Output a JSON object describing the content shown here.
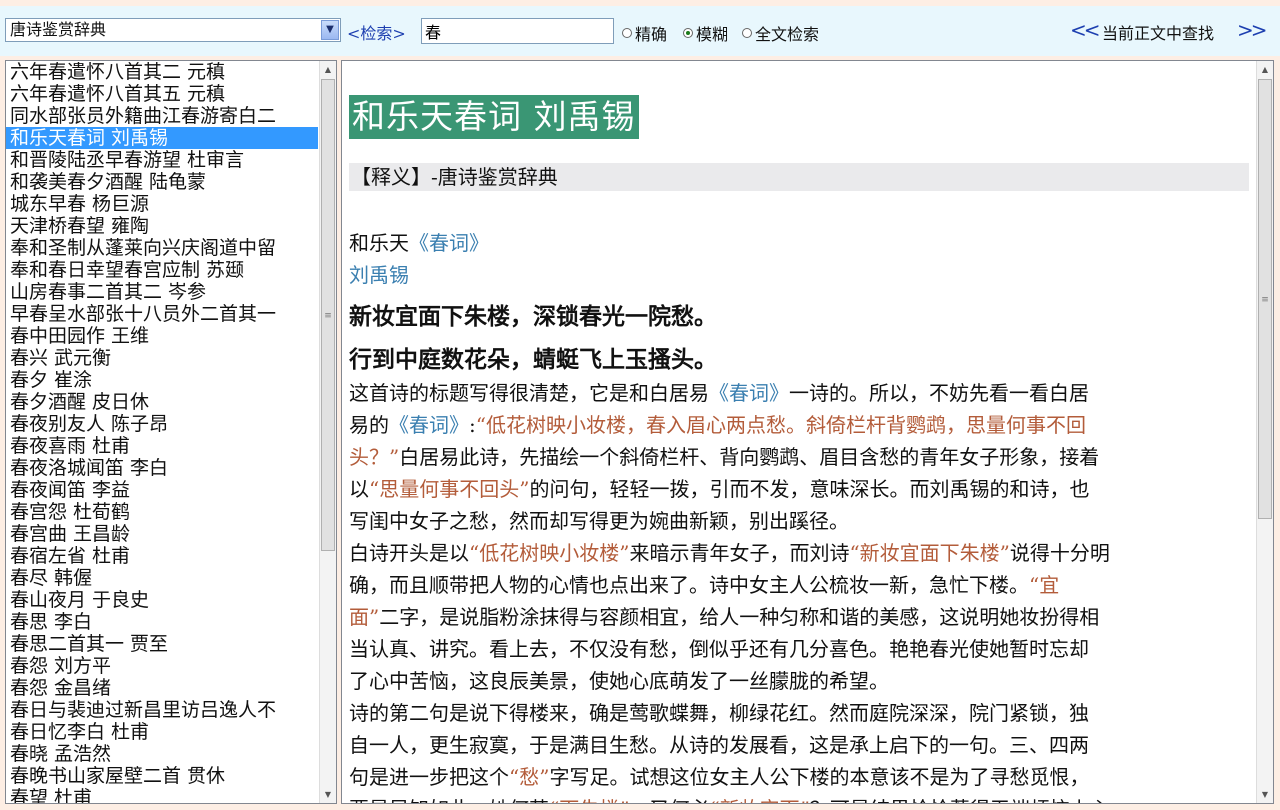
{
  "toolbar": {
    "dictionary": "唐诗鉴赏辞典",
    "search_label": "<检索>",
    "search_value": "春",
    "modes": [
      {
        "label": "精确",
        "selected": false
      },
      {
        "label": "模糊",
        "selected": true
      },
      {
        "label": "全文检索",
        "selected": false
      }
    ],
    "prev_label": "<<",
    "find_label": "当前正文中查找",
    "next_label": ">>"
  },
  "list": {
    "selected_index": 3,
    "items": [
      "六年春遣怀八首其二  元稹",
      "六年春遣怀八首其五  元稹",
      "同水部张员外籍曲江春游寄白二",
      "和乐天春词  刘禹锡",
      "和晋陵陆丞早春游望  杜审言",
      "和袭美春夕酒醒  陆龟蒙",
      "城东早春  杨巨源",
      "天津桥春望  雍陶",
      "奉和圣制从蓬莱向兴庆阁道中留",
      "奉和春日幸望春宫应制  苏颋",
      "山房春事二首其二  岑参",
      "早春呈水部张十八员外二首其一",
      "春中田园作  王维",
      "春兴  武元衡",
      "春夕  崔涂",
      "春夕酒醒  皮日休",
      "春夜别友人  陈子昂",
      "春夜喜雨  杜甫",
      "春夜洛城闻笛  李白",
      "春夜闻笛  李益",
      "春宫怨  杜荀鹤",
      "春宫曲  王昌龄",
      "春宿左省  杜甫",
      "春尽  韩偓",
      "春山夜月  于良史",
      "春思  李白",
      "春思二首其一  贾至",
      "春怨  刘方平",
      "春怨  金昌绪",
      "春日与裴迪过新昌里访吕逸人不",
      "春日忆李白  杜甫",
      "春晓  孟浩然",
      "春晚书山家屋壁二首  贯休",
      "春望  杜甫"
    ]
  },
  "entry": {
    "title": "和乐天春词  刘禹锡",
    "gloss": "【释义】-唐诗鉴赏辞典",
    "origin_prefix": "和乐天",
    "origin_link": "《春词》",
    "author": "刘禹锡",
    "poem": [
      "新妆宜面下朱楼，深锁春光一院愁。",
      "行到中庭数花朵，蜻蜓飞上玉搔头。"
    ],
    "commentary": [
      [
        [
          "t",
          "这首诗的标题写得很清楚，它是和白居易"
        ],
        [
          "l",
          "《春词》"
        ],
        [
          "t",
          "一诗的。所以，不妨先看一看白居"
        ]
      ],
      [
        [
          "t",
          "易的"
        ],
        [
          "l",
          "《春词》"
        ],
        [
          "t",
          ":"
        ],
        [
          "q",
          "“低花树映小妆楼，春入眉心两点愁。斜倚栏杆背鹦鹉，思量何事不回"
        ]
      ],
      [
        [
          "q",
          "头？”"
        ],
        [
          "t",
          "白居易此诗，先描绘一个斜倚栏杆、背向鹦鹉、眉目含愁的青年女子形象，接着"
        ]
      ],
      [
        [
          "t",
          "以"
        ],
        [
          "q",
          "“思量何事不回头”"
        ],
        [
          "t",
          "的问句，轻轻一拨，引而不发，意味深长。而刘禹锡的和诗，也"
        ]
      ],
      [
        [
          "t",
          "写闺中女子之愁，然而却写得更为婉曲新颖，别出蹊径。"
        ]
      ],
      [
        [
          "t",
          "白诗开头是以"
        ],
        [
          "q",
          "“低花树映小妆楼”"
        ],
        [
          "t",
          "来暗示青年女子，而刘诗"
        ],
        [
          "q",
          "“新妆宜面下朱楼”"
        ],
        [
          "t",
          "说得十分明"
        ]
      ],
      [
        [
          "t",
          "确，而且顺带把人物的心情也点出来了。诗中女主人公梳妆一新，急忙下楼。"
        ],
        [
          "q",
          "“宜"
        ]
      ],
      [
        [
          "q",
          "面”"
        ],
        [
          "t",
          "二字，是说脂粉涂抹得与容颜相宜，给人一种匀称和谐的美感，这说明她妆扮得相"
        ]
      ],
      [
        [
          "t",
          "当认真、讲究。看上去，不仅没有愁，倒似乎还有几分喜色。艳艳春光使她暂时忘却"
        ]
      ],
      [
        [
          "t",
          "了心中苦恼，这良辰美景，使她心底萌发了一丝朦胧的希望。"
        ]
      ],
      [
        [
          "t",
          "诗的第二句是说下得楼来，确是莺歌蝶舞，柳绿花红。然而庭院深深，院门紧锁，独"
        ]
      ],
      [
        [
          "t",
          "自一人，更生寂寞，于是满目生愁。从诗的发展看，这是承上启下的一句。三、四两"
        ]
      ],
      [
        [
          "t",
          "句是进一步把这个"
        ],
        [
          "q",
          "“愁”"
        ],
        [
          "t",
          "字写足。试想这位女主人公下楼的本意该不是为了寻愁觅恨，"
        ]
      ],
      [
        [
          "t",
          "要是早知如此，她何苦"
        ],
        [
          "q",
          "“下朱楼”"
        ],
        [
          "t",
          "，又何必"
        ],
        [
          "q",
          "“新妆宜面”"
        ],
        [
          "t",
          "？可是结果恰恰惹得无端烦恼上心"
        ]
      ]
    ]
  }
}
